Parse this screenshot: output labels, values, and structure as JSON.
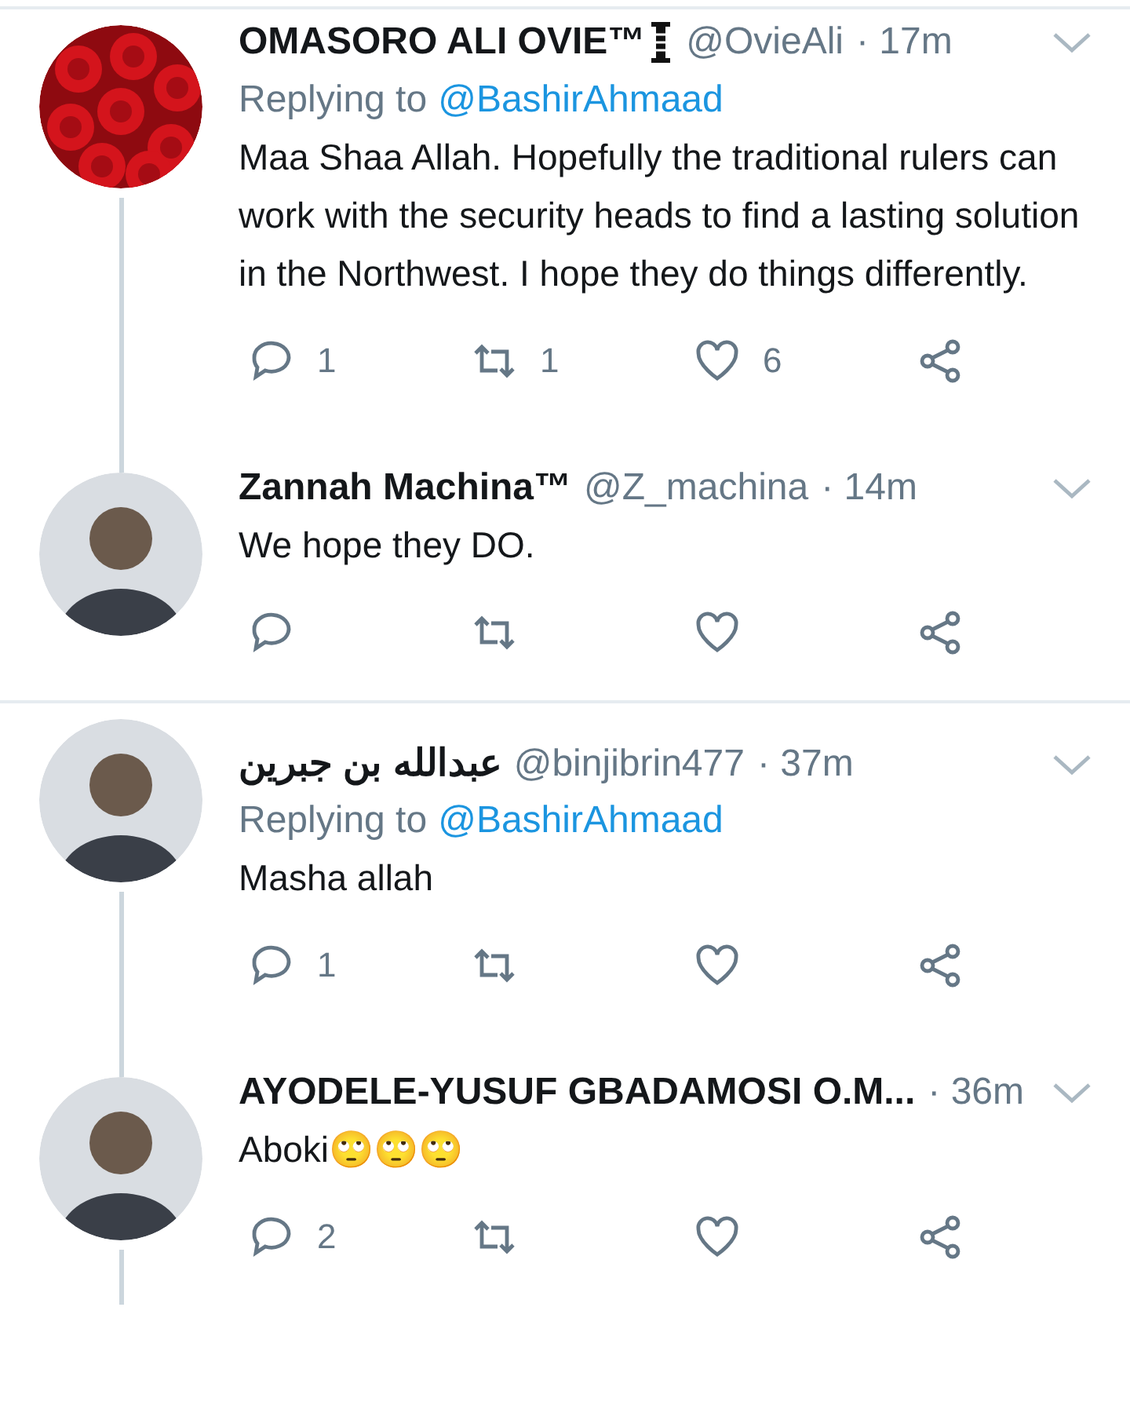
{
  "tweets": [
    {
      "name": "OMASORO ALI OVIE™",
      "name_badge": true,
      "handle": "@OvieAli",
      "time": "· 17m",
      "replying_label": "Replying to",
      "replying_to": "@BashirAhmaad",
      "text": "Maa Shaa Allah. Hopefully the traditional rulers can work with the security heads to find a lasting solution in the Northwest. I hope they do things differently.",
      "counts": {
        "reply": "1",
        "retweet": "1",
        "like": "6"
      },
      "thread_below": true
    },
    {
      "avatar": {
        "kind": "person"
      },
      "name": "Zannah Machina™",
      "name_badge": false,
      "handle": "@Z_machina",
      "time": "· 14m",
      "text": "We hope they DO.",
      "thread_below": false
    },
    {
      "avatar": {
        "kind": "person"
      },
      "name": "عبدالله بن جبرين",
      "name_badge": false,
      "handle": "@binjibrin477",
      "time": "· 37m",
      "replying_label": "Replying to",
      "replying_to": "@BashirAhmaad",
      "text": "Masha allah",
      "counts": {
        "reply": "1"
      },
      "thread_below": true
    },
    {
      "avatar": {
        "kind": "person"
      },
      "name": "AYODELE-YUSUF GBADAMOSI O.M...",
      "name_badge": false,
      "time": "· 36m",
      "text": "Aboki🙄🙄🙄",
      "counts": {
        "reply": "2"
      },
      "thread_below": true
    }
  ]
}
